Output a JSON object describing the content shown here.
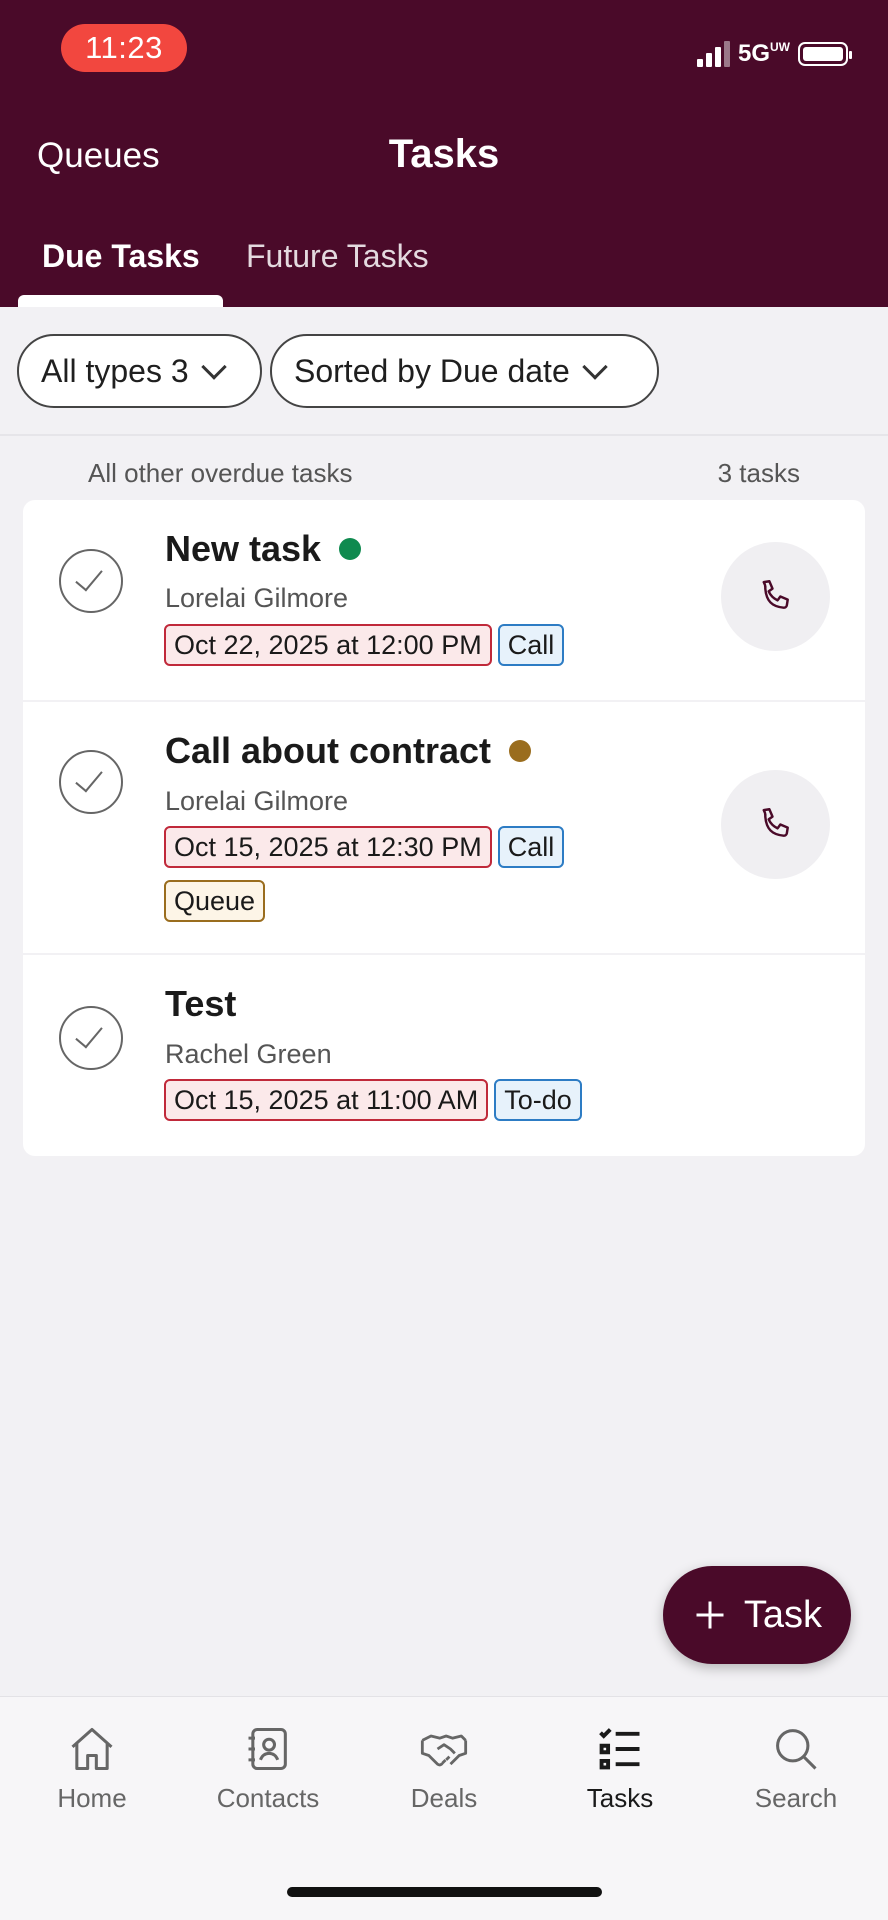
{
  "status_bar": {
    "time": "11:23",
    "network": "5G",
    "network_sup": "UW"
  },
  "header": {
    "queues_label": "Queues",
    "title": "Tasks",
    "tabs": [
      {
        "label": "Due Tasks",
        "active": true
      },
      {
        "label": "Future Tasks",
        "active": false
      }
    ]
  },
  "filters": {
    "types_label": "All types 3",
    "sort_label": "Sorted by Due date"
  },
  "section": {
    "label": "All other overdue tasks",
    "count": "3 tasks"
  },
  "tasks": [
    {
      "title": "New task",
      "status_color": "#0f8a4f",
      "contact": "Lorelai Gilmore",
      "due": "Oct 22, 2025 at 12:00 PM",
      "type": "Call",
      "has_call_button": true
    },
    {
      "title": "Call about contract",
      "status_color": "#9a6d1e",
      "contact": "Lorelai Gilmore",
      "due": "Oct 15, 2025 at 12:30 PM",
      "type": "Call",
      "extra_badge": "Queue",
      "has_call_button": true
    },
    {
      "title": "Test",
      "contact": "Rachel Green",
      "due": "Oct 15, 2025 at 11:00 AM",
      "type": "To-do",
      "has_call_button": false
    }
  ],
  "fab": {
    "label": "Task",
    "icon": "plus-icon"
  },
  "bottom_nav": [
    {
      "label": "Home",
      "icon": "home-icon",
      "active": false
    },
    {
      "label": "Contacts",
      "icon": "contacts-icon",
      "active": false
    },
    {
      "label": "Deals",
      "icon": "handshake-icon",
      "active": false
    },
    {
      "label": "Tasks",
      "icon": "tasks-icon",
      "active": true
    },
    {
      "label": "Search",
      "icon": "search-icon",
      "active": false
    }
  ],
  "colors": {
    "brand": "#4a0a29",
    "status_time_bg": "#f2473f",
    "due_border": "#c0293a",
    "type_border": "#2d7cc4"
  }
}
